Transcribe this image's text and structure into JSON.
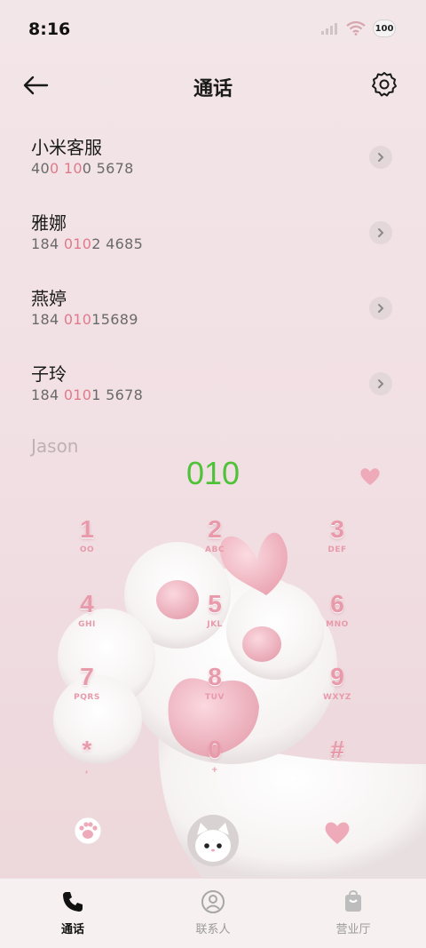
{
  "status_bar": {
    "time": "8:16",
    "battery": "100",
    "icons": [
      "signal-icon",
      "wifi-icon",
      "battery-icon"
    ]
  },
  "header": {
    "title": "通话",
    "back_icon": "arrow-left-icon",
    "settings_icon": "gear-icon"
  },
  "contacts": [
    {
      "name": "小米客服",
      "number_parts": [
        "40",
        "0 10",
        "0 5678"
      ]
    },
    {
      "name": "雅娜",
      "number_parts": [
        "184 ",
        "010",
        "2 4685"
      ]
    },
    {
      "name": "燕婷",
      "number_parts": [
        "184 ",
        "010",
        "15689"
      ]
    },
    {
      "name": "子玲",
      "number_parts": [
        "184 ",
        "010",
        "1 5678"
      ]
    },
    {
      "name": "Jason",
      "number_parts": [
        "",
        "",
        ""
      ]
    }
  ],
  "dial": {
    "number": "010"
  },
  "keypad": {
    "keys": [
      {
        "digit": "1",
        "letters": "OO"
      },
      {
        "digit": "2",
        "letters": "ABC"
      },
      {
        "digit": "3",
        "letters": "DEF"
      },
      {
        "digit": "4",
        "letters": "GHI"
      },
      {
        "digit": "5",
        "letters": "JKL"
      },
      {
        "digit": "6",
        "letters": "MNO"
      },
      {
        "digit": "7",
        "letters": "PQRS"
      },
      {
        "digit": "8",
        "letters": "TUV"
      },
      {
        "digit": "9",
        "letters": "WXYZ"
      },
      {
        "digit": "*",
        "letters": ","
      },
      {
        "digit": "0",
        "letters": "+"
      },
      {
        "digit": "#",
        "letters": ""
      }
    ]
  },
  "bottom_nav": {
    "items": [
      {
        "label": "通话",
        "icon": "phone-icon",
        "active": true
      },
      {
        "label": "联系人",
        "icon": "contacts-icon",
        "active": false
      },
      {
        "label": "营业厅",
        "icon": "shop-bag-icon",
        "active": false
      }
    ]
  },
  "colors": {
    "accent_pink": "#e89aaa",
    "dial_green": "#4fc23a",
    "highlight": "#e07a8a",
    "background": "#f1dfe3"
  }
}
